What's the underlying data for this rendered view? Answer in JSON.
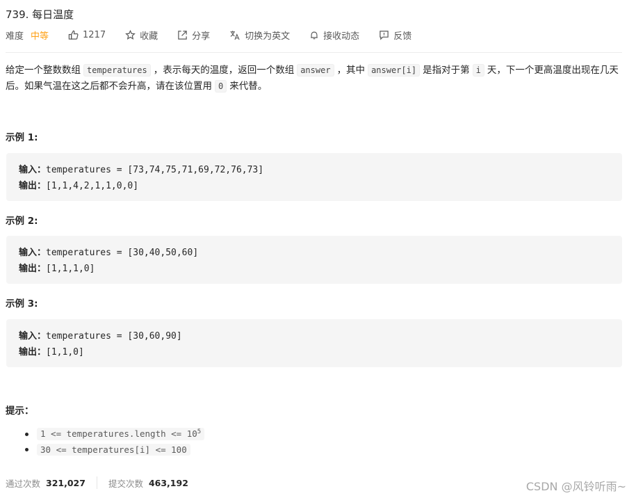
{
  "problem": {
    "title": "739. 每日温度",
    "difficulty_label": "难度",
    "difficulty_value": "中等",
    "likes": "1217",
    "favorite": "收藏",
    "share": "分享",
    "switch_lang": "切换为英文",
    "notify": "接收动态",
    "feedback": "反馈"
  },
  "description": {
    "p1": "给定一个整数数组",
    "c1": "temperatures",
    "p2": "，表示每天的温度，返回一个数组",
    "c2": "answer",
    "p3": "，其中",
    "c3": "answer[i]",
    "p4": "是指对于第",
    "c4": "i",
    "p5": "天，下一个更高温度出现在几天后。如果气温在这之后都不会升高，请在该位置用",
    "c5": "0",
    "p6": "来代替。"
  },
  "examples": [
    {
      "title": "示例 1:",
      "input_label": "输入：",
      "input": "temperatures = [73,74,75,71,69,72,76,73]",
      "output_label": "输出：",
      "output": "[1,1,4,2,1,1,0,0]"
    },
    {
      "title": "示例 2:",
      "input_label": "输入：",
      "input": "temperatures = [30,40,50,60]",
      "output_label": "输出：",
      "output": "[1,1,1,0]"
    },
    {
      "title": "示例 3:",
      "input_label": "输入：",
      "input": "temperatures = [30,60,90]",
      "output_label": "输出：",
      "output": "[1,1,0]"
    }
  ],
  "hints": {
    "title": "提示：",
    "h1": "1 <=  temperatures.length <= 10",
    "h1_sup": "5",
    "h2": "30 <=  temperatures[i]  <= 100"
  },
  "stats": {
    "accepted_label": "通过次数",
    "accepted": "321,027",
    "submitted_label": "提交次数",
    "submitted": "463,192"
  },
  "watermark": "CSDN @风铃听雨~",
  "colors": {
    "difficulty_medium": "#ffa116"
  }
}
